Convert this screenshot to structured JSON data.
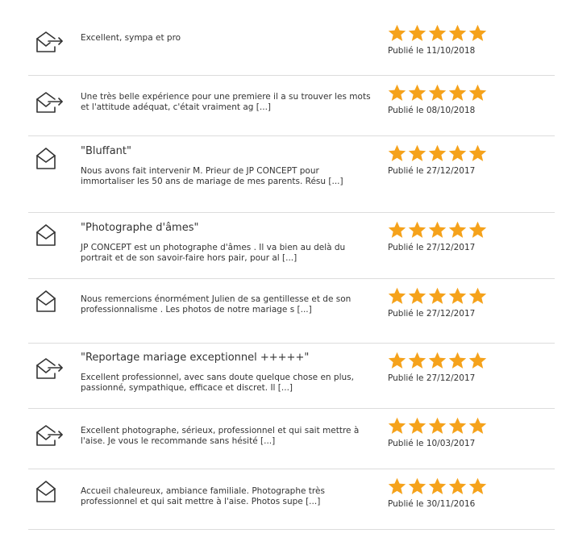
{
  "reviews": [
    {
      "icon": "envelope-arrow-icon",
      "title": "",
      "body": "Excellent, sympa et pro",
      "stars": 5,
      "date": "Publié le 11/10/2018"
    },
    {
      "icon": "envelope-arrow-icon",
      "title": "",
      "body": "Une très belle expérience pour une premiere il a su trouver les mots et l'attitude adéquat, c'était vraiment ag [...]",
      "stars": 5,
      "date": "Publié le 08/10/2018"
    },
    {
      "icon": "envelope-open-icon",
      "title": "\"Bluffant\"",
      "body": "Nous avons fait intervenir M. Prieur de JP CONCEPT pour immortaliser les 50 ans de mariage de mes parents. Résu [...]",
      "stars": 5,
      "date": "Publié le 27/12/2017"
    },
    {
      "icon": "envelope-open-icon",
      "title": "\"Photographe d'âmes\"",
      "body": "JP CONCEPT est un photographe d'âmes . Il va bien au delà du portrait et de son savoir-faire hors pair, pour al [...]",
      "stars": 5,
      "date": "Publié le 27/12/2017"
    },
    {
      "icon": "envelope-open-icon",
      "title": "",
      "body": "Nous remercions énormément Julien de sa gentillesse et de son professionnalisme . Les photos de notre mariage s [...]",
      "stars": 5,
      "date": "Publié le 27/12/2017"
    },
    {
      "icon": "envelope-arrow-icon",
      "title": "\"Reportage mariage exceptionnel +++++\"",
      "body": "Excellent professionnel, avec sans doute quelque chose en plus, passionné, sympathique, efficace et discret. Il [...]",
      "stars": 5,
      "date": "Publié le 27/12/2017"
    },
    {
      "icon": "envelope-arrow-icon",
      "title": "",
      "body": "Excellent photographe, sérieux, professionnel et qui sait mettre à l'aise. Je vous le recommande sans hésité [...]",
      "stars": 5,
      "date": "Publié le 10/03/2017"
    },
    {
      "icon": "envelope-open-icon",
      "title": "",
      "body": "Accueil chaleureux, ambiance familiale. Photographe très professionnel et qui sait mettre à l'aise. Photos supe [...]",
      "stars": 5,
      "date": "Publié le 30/11/2016"
    }
  ],
  "colors": {
    "star": "#f5a21b",
    "text": "#333333",
    "divider": "#dcdcdc"
  }
}
